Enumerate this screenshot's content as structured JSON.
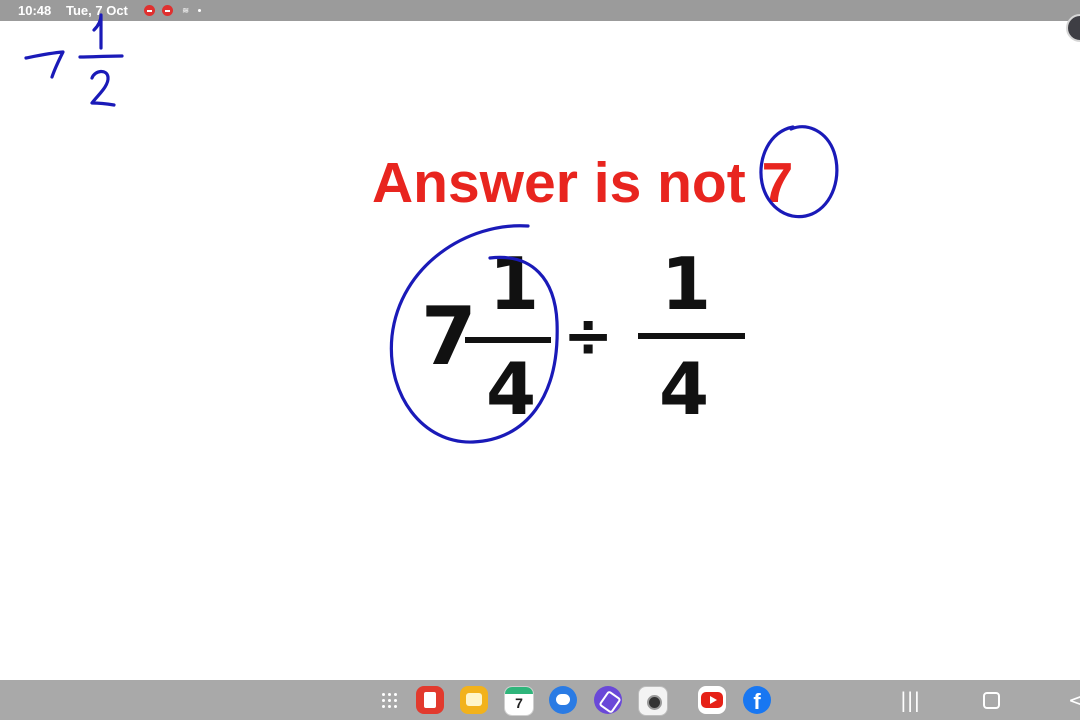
{
  "status_bar": {
    "time": "10:48",
    "date": "Tue, 7 Oct",
    "icons": [
      "notification-badge-icon",
      "notification-badge-icon",
      "vibrate-icon",
      "more-dot-icon"
    ]
  },
  "whiteboard": {
    "corner_note": {
      "whole": "7",
      "numerator": "1",
      "denominator": "2"
    },
    "heading": "Answer is not 7",
    "problem": {
      "mixed_whole": "7",
      "mixed_numerator": "1",
      "mixed_denominator": "4",
      "operator": "÷",
      "divisor_numerator": "1",
      "divisor_denominator": "4"
    },
    "ink_color": "#1a1ab8",
    "heading_color": "#e8251f"
  },
  "taskbar": {
    "apps": [
      {
        "name": "apps-grid-icon"
      },
      {
        "name": "notes-app-icon",
        "color": "#e23a2e"
      },
      {
        "name": "memo-app-icon",
        "color": "#f2b21c"
      },
      {
        "name": "calendar-app-icon",
        "day": "7",
        "color": "#2fb57b"
      },
      {
        "name": "messages-app-icon",
        "color": "#2a7be4"
      },
      {
        "name": "purple-app-icon",
        "color": "#6a48d8"
      },
      {
        "name": "camera-app-icon"
      },
      {
        "name": "youtube-app-icon",
        "color": "#e62117"
      },
      {
        "name": "facebook-app-icon",
        "letter": "f",
        "color": "#1877f2"
      }
    ],
    "nav": {
      "recents": "|||",
      "back": "<"
    }
  }
}
